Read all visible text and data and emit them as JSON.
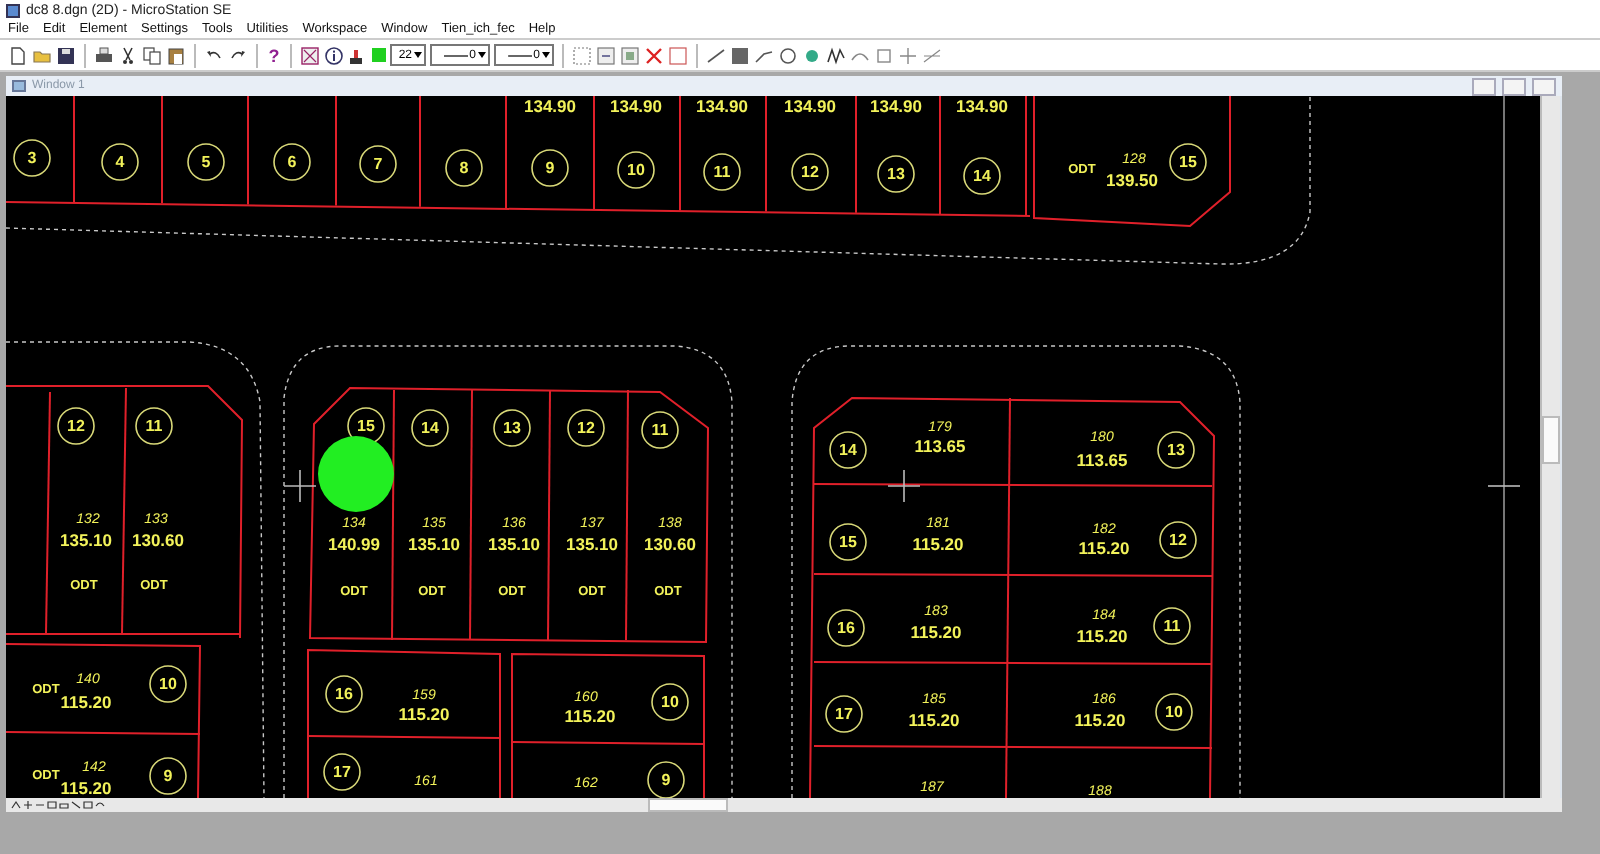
{
  "window": {
    "title": "dc8 8.dgn (2D) - MicroStation SE"
  },
  "menu": [
    "File",
    "Edit",
    "Element",
    "Settings",
    "Tools",
    "Utilities",
    "Workspace",
    "Window",
    "Tien_ich_fec",
    "Help"
  ],
  "toolbar": {
    "help": "?",
    "combos": [
      "22",
      "0",
      "0"
    ]
  },
  "view": {
    "title": "Window 1"
  },
  "drawing": {
    "texts": [
      {
        "kind": "area",
        "text": "134.90"
      },
      {
        "kind": "area",
        "text": "134.90"
      },
      {
        "kind": "area",
        "text": "134.90"
      },
      {
        "kind": "area",
        "text": "134.90"
      },
      {
        "kind": "area",
        "text": "134.90"
      },
      {
        "kind": "area",
        "text": "134.90"
      },
      {
        "kind": "marker",
        "text": "3"
      },
      {
        "kind": "marker",
        "text": "4"
      },
      {
        "kind": "marker",
        "text": "5"
      },
      {
        "kind": "marker",
        "text": "6"
      },
      {
        "kind": "marker",
        "text": "7"
      },
      {
        "kind": "marker",
        "text": "8"
      },
      {
        "kind": "marker",
        "text": "9"
      },
      {
        "kind": "marker",
        "text": "10"
      },
      {
        "kind": "marker",
        "text": "11"
      },
      {
        "kind": "marker",
        "text": "12"
      },
      {
        "kind": "marker",
        "text": "13"
      },
      {
        "kind": "marker",
        "text": "14"
      },
      {
        "kind": "label",
        "text": "ODT"
      },
      {
        "kind": "number",
        "text": "128"
      },
      {
        "kind": "area",
        "text": "139.50"
      },
      {
        "kind": "marker",
        "text": "15"
      },
      {
        "kind": "marker",
        "text": "12"
      },
      {
        "kind": "marker",
        "text": "11"
      },
      {
        "kind": "number",
        "text": "132"
      },
      {
        "kind": "area",
        "text": "135.10"
      },
      {
        "kind": "number",
        "text": "133"
      },
      {
        "kind": "area",
        "text": "130.60"
      },
      {
        "kind": "label",
        "text": "ODT"
      },
      {
        "kind": "label",
        "text": "ODT"
      },
      {
        "kind": "label",
        "text": "ODT"
      },
      {
        "kind": "number",
        "text": "140"
      },
      {
        "kind": "area",
        "text": "115.20"
      },
      {
        "kind": "marker",
        "text": "10"
      },
      {
        "kind": "label",
        "text": "ODT"
      },
      {
        "kind": "number",
        "text": "142"
      },
      {
        "kind": "area",
        "text": "115.20"
      },
      {
        "kind": "marker",
        "text": "9"
      },
      {
        "kind": "marker",
        "text": "15"
      },
      {
        "kind": "marker",
        "text": "14"
      },
      {
        "kind": "marker",
        "text": "13"
      },
      {
        "kind": "marker",
        "text": "12"
      },
      {
        "kind": "marker",
        "text": "11"
      },
      {
        "kind": "number",
        "text": "134"
      },
      {
        "kind": "number",
        "text": "135"
      },
      {
        "kind": "number",
        "text": "136"
      },
      {
        "kind": "number",
        "text": "137"
      },
      {
        "kind": "number",
        "text": "138"
      },
      {
        "kind": "area",
        "text": "140.99"
      },
      {
        "kind": "area",
        "text": "135.10"
      },
      {
        "kind": "area",
        "text": "135.10"
      },
      {
        "kind": "area",
        "text": "135.10"
      },
      {
        "kind": "area",
        "text": "130.60"
      },
      {
        "kind": "label",
        "text": "ODT"
      },
      {
        "kind": "label",
        "text": "ODT"
      },
      {
        "kind": "label",
        "text": "ODT"
      },
      {
        "kind": "label",
        "text": "ODT"
      },
      {
        "kind": "label",
        "text": "ODT"
      },
      {
        "kind": "marker",
        "text": "16"
      },
      {
        "kind": "number",
        "text": "159"
      },
      {
        "kind": "area",
        "text": "115.20"
      },
      {
        "kind": "number",
        "text": "160"
      },
      {
        "kind": "area",
        "text": "115.20"
      },
      {
        "kind": "marker",
        "text": "10"
      },
      {
        "kind": "marker",
        "text": "17"
      },
      {
        "kind": "number",
        "text": "161"
      },
      {
        "kind": "number",
        "text": "162"
      },
      {
        "kind": "marker",
        "text": "9"
      },
      {
        "kind": "marker",
        "text": "14"
      },
      {
        "kind": "number",
        "text": "179"
      },
      {
        "kind": "area",
        "text": "113.65"
      },
      {
        "kind": "number",
        "text": "180"
      },
      {
        "kind": "area",
        "text": "113.65"
      },
      {
        "kind": "marker",
        "text": "13"
      },
      {
        "kind": "marker",
        "text": "15"
      },
      {
        "kind": "number",
        "text": "181"
      },
      {
        "kind": "area",
        "text": "115.20"
      },
      {
        "kind": "number",
        "text": "182"
      },
      {
        "kind": "area",
        "text": "115.20"
      },
      {
        "kind": "marker",
        "text": "12"
      },
      {
        "kind": "marker",
        "text": "16"
      },
      {
        "kind": "number",
        "text": "183"
      },
      {
        "kind": "area",
        "text": "115.20"
      },
      {
        "kind": "number",
        "text": "184"
      },
      {
        "kind": "area",
        "text": "115.20"
      },
      {
        "kind": "marker",
        "text": "11"
      },
      {
        "kind": "marker",
        "text": "17"
      },
      {
        "kind": "number",
        "text": "185"
      },
      {
        "kind": "area",
        "text": "115.20"
      },
      {
        "kind": "number",
        "text": "186"
      },
      {
        "kind": "area",
        "text": "115.20"
      },
      {
        "kind": "marker",
        "text": "10"
      },
      {
        "kind": "number",
        "text": "187"
      },
      {
        "kind": "number",
        "text": "188"
      }
    ]
  }
}
